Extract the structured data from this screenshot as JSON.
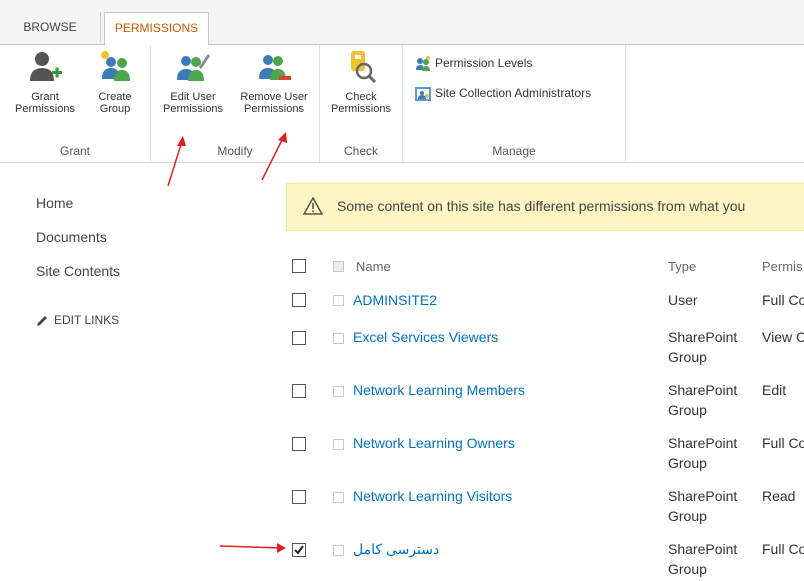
{
  "tabs": [
    {
      "label": "BROWSE"
    },
    {
      "label": "PERMISSIONS"
    }
  ],
  "ribbon": {
    "grant": {
      "title": "Grant",
      "grant_permissions": "Grant Permissions",
      "create_group": "Create Group"
    },
    "modify": {
      "title": "Modify",
      "edit_user": "Edit User Permissions",
      "remove_user": "Remove User Permissions"
    },
    "check": {
      "title": "Check",
      "check_permissions": "Check Permissions"
    },
    "manage": {
      "title": "Manage",
      "permission_levels": "Permission Levels",
      "site_collection_admins": "Site Collection Administrators"
    }
  },
  "nav": {
    "items": [
      "Home",
      "Documents",
      "Site Contents"
    ],
    "edit_links": "EDIT LINKS"
  },
  "banner": {
    "text": "Some content on this site has different permissions from what you"
  },
  "table": {
    "headers": {
      "name": "Name",
      "type": "Type",
      "perm": "Permis"
    },
    "rows": [
      {
        "name": "ADMINSITE2",
        "type1": "User",
        "type2": "",
        "perm": "Full Co",
        "checked": false
      },
      {
        "name": "Excel Services Viewers",
        "type1": "SharePoint",
        "type2": "Group",
        "perm": "View C",
        "checked": false
      },
      {
        "name": "Network Learning Members",
        "type1": "SharePoint",
        "type2": "Group",
        "perm": "Edit",
        "checked": false
      },
      {
        "name": "Network Learning Owners",
        "type1": "SharePoint",
        "type2": "Group",
        "perm": "Full Co",
        "checked": false
      },
      {
        "name": "Network Learning Visitors",
        "type1": "SharePoint",
        "type2": "Group",
        "perm": "Read",
        "checked": false
      },
      {
        "name": "دسترسی کامل",
        "type1": "SharePoint",
        "type2": "Group",
        "perm": "Full Co",
        "checked": true
      }
    ]
  },
  "colors": {
    "accent": "#d25a00",
    "link": "#0072c6",
    "banner_bg": "#fdf6c4",
    "annotation": "#e02020"
  }
}
